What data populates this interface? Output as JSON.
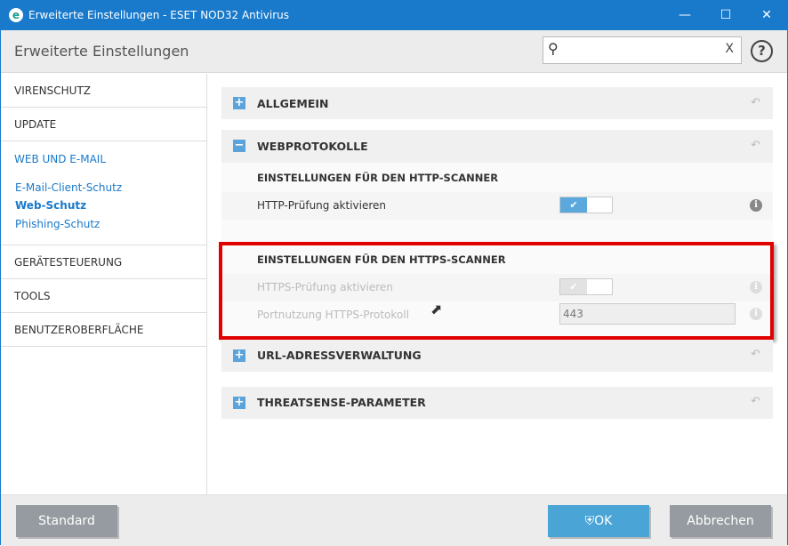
{
  "window": {
    "title": "Erweiterte Einstellungen - ESET NOD32 Antivirus",
    "logo": "e"
  },
  "header": {
    "title": "Erweiterte Einstellungen",
    "search_placeholder": "",
    "clear": "X",
    "help": "?"
  },
  "sidebar": {
    "items": [
      "VIRENSCHUTZ",
      "UPDATE",
      "WEB UND E-MAIL",
      "GERÄTESTEUERUNG",
      "TOOLS",
      "BENUTZEROBERFLÄCHE"
    ],
    "subitems": [
      "E-Mail-Client-Schutz",
      "Web-Schutz",
      "Phishing-Schutz"
    ]
  },
  "sections": {
    "allgemein": "ALLGEMEIN",
    "webprotokolle": "WEBPROTOKOLLE",
    "url": "URL-ADRESSVERWALTUNG",
    "threatsense": "THREATSENSE-PARAMETER"
  },
  "http": {
    "heading": "EINSTELLUNGEN FÜR DEN HTTP-SCANNER",
    "enable_label": "HTTP-Prüfung aktivieren",
    "enabled": true
  },
  "https": {
    "heading": "EINSTELLUNGEN FÜR DEN HTTPS-SCANNER",
    "enable_label": "HTTPS-Prüfung aktivieren",
    "enabled": true,
    "port_label": "Portnutzung HTTPS-Protokoll",
    "port_value": "443"
  },
  "footer": {
    "standard": "Standard",
    "ok": "OK",
    "cancel": "Abbrechen"
  },
  "colors": {
    "accent": "#1979ca",
    "highlight": "#e00000"
  }
}
